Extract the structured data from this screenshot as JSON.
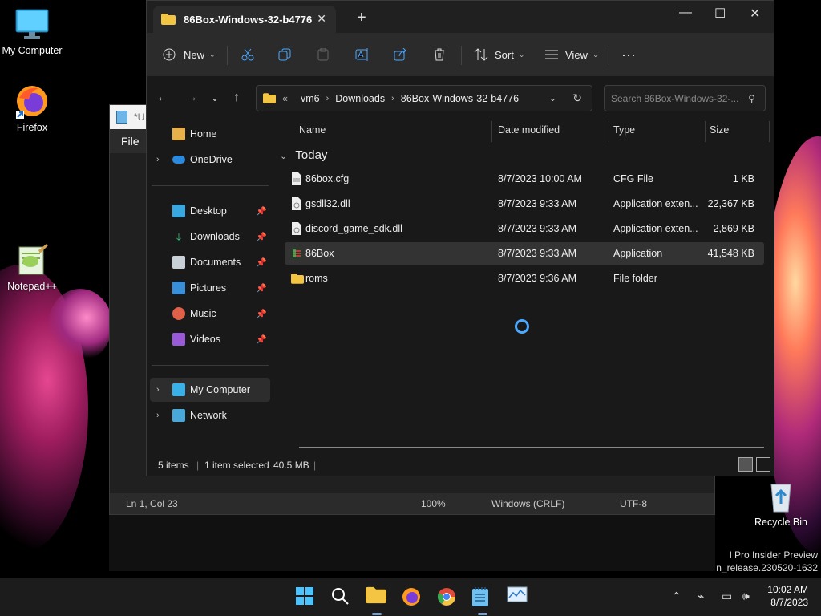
{
  "desktop": {
    "icons": [
      {
        "label": "My Computer",
        "icon": "monitor-icon"
      },
      {
        "label": "Firefox",
        "icon": "firefox-icon"
      },
      {
        "label": "Notepad++",
        "icon": "notepadpp-icon"
      },
      {
        "label": "Recycle Bin",
        "icon": "recycle-bin-icon"
      }
    ],
    "watermark_line1": "l Pro Insider Preview",
    "watermark_line2": "n_release.230520-1632"
  },
  "notepadpp": {
    "title": "*U",
    "menu_file": "File",
    "status_pos": "Ln 1, Col 23",
    "status_zoom": "100%",
    "status_eol": "Windows (CRLF)",
    "status_enc": "UTF-8"
  },
  "explorer": {
    "tab_title": "86Box-Windows-32-b4776",
    "toolbar": {
      "new_label": "New",
      "sort_label": "Sort",
      "view_label": "View"
    },
    "address": {
      "overflow": "«",
      "crumbs": [
        "vm6",
        "Downloads",
        "86Box-Windows-32-b4776"
      ]
    },
    "search_placeholder": "Search 86Box-Windows-32-...",
    "nav": {
      "home": "Home",
      "onedrive": "OneDrive",
      "desktop": "Desktop",
      "downloads": "Downloads",
      "documents": "Documents",
      "pictures": "Pictures",
      "music": "Music",
      "videos": "Videos",
      "my_computer": "My Computer",
      "network": "Network"
    },
    "columns": {
      "name": "Name",
      "date": "Date modified",
      "type": "Type",
      "size": "Size"
    },
    "group_label": "Today",
    "files": [
      {
        "name": "86box.cfg",
        "date": "8/7/2023 10:00 AM",
        "type": "CFG File",
        "size": "1 KB"
      },
      {
        "name": "gsdll32.dll",
        "date": "8/7/2023 9:33 AM",
        "type": "Application exten...",
        "size": "22,367 KB"
      },
      {
        "name": "discord_game_sdk.dll",
        "date": "8/7/2023 9:33 AM",
        "type": "Application exten...",
        "size": "2,869 KB"
      },
      {
        "name": "86Box",
        "date": "8/7/2023 9:33 AM",
        "type": "Application",
        "size": "41,548 KB"
      },
      {
        "name": "roms",
        "date": "8/7/2023 9:36 AM",
        "type": "File folder",
        "size": ""
      }
    ],
    "status": {
      "items": "5 items",
      "selected": "1 item selected",
      "selected_size": "40.5 MB"
    }
  },
  "taskbar": {
    "time": "10:02 AM",
    "date": "8/7/2023"
  }
}
